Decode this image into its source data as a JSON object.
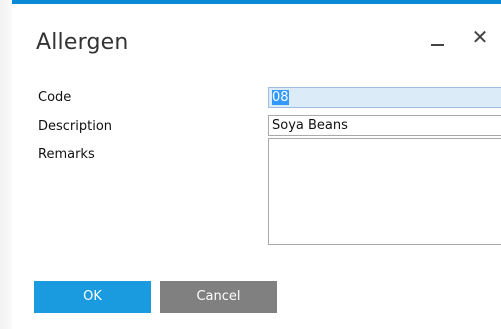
{
  "window": {
    "title": "Allergen",
    "minimize_icon": "minimize-icon",
    "close_icon": "close-icon",
    "close_glyph": "✕",
    "accent_color": "#0a8ad6"
  },
  "form": {
    "code_label": "Code",
    "code_value": "08",
    "description_label": "Description",
    "description_value": "Soya Beans",
    "remarks_label": "Remarks",
    "remarks_value": ""
  },
  "buttons": {
    "ok_label": "OK",
    "cancel_label": "Cancel",
    "ok_color": "#1a9be0",
    "cancel_color": "#808080"
  }
}
